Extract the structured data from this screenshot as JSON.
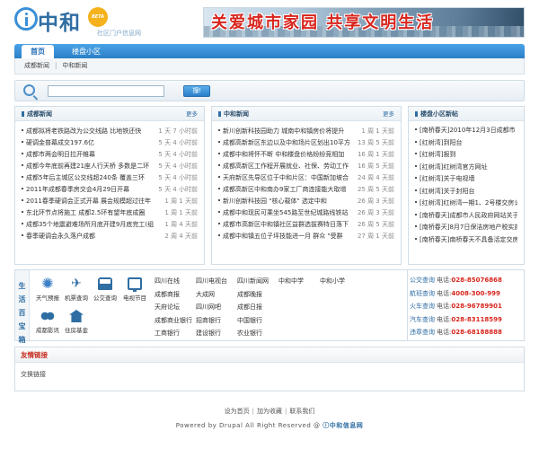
{
  "header": {
    "logo_title": "中和",
    "logo_badge": "BETA",
    "logo_subtitle": "社区门户信息网",
    "banner_text": "关爱城市家园 共享文明生活"
  },
  "nav": {
    "tabs": [
      {
        "label": "首页",
        "active": true
      },
      {
        "label": "楼盘小区",
        "active": false
      }
    ]
  },
  "subnav": {
    "items": [
      "成都新闻",
      "中和新闻"
    ]
  },
  "search": {
    "value": "",
    "placeholder": "",
    "button_label": "搜!"
  },
  "panels": {
    "chengdu_news": {
      "title": "成都新闻",
      "more": "更多",
      "items": [
        {
          "text": "成都拟将老铁路改为公交线路 比地铁还快",
          "time": "1 天 7 小时前"
        },
        {
          "text": "硬调金普幕成交197.6亿",
          "time": "5 天 4 小时前"
        },
        {
          "text": "成都市两会明日拉开帷幕",
          "time": "5 天 4 小时前"
        },
        {
          "text": "成都今年底前再建21座人行天桥 多数是二环",
          "time": "5 天 4 小时前"
        },
        {
          "text": "成都5年后主城区公交线超240条 覆盖三环",
          "time": "5 天 4 小时前"
        },
        {
          "text": "2011年成都春季房交会4月29日开幕",
          "time": "5 天 4 小时前"
        },
        {
          "text": "2011春季硬调会正式开幕 展会规模超过往年",
          "time": "1 周 1 天前"
        },
        {
          "text": "东北环节点将施工 成都2.5环有望年底成圈",
          "time": "1 周 1 天前"
        },
        {
          "text": "成都35个地震避难场所月底开建9月底完工(组",
          "time": "1 周 4 天前"
        },
        {
          "text": "春季硬调会永久落户成都",
          "time": "2 周 4 天前"
        }
      ]
    },
    "zhonghe_news": {
      "title": "中和新闻",
      "more": "更多",
      "items": [
        {
          "text": "新川创新科技园助力 城南中和镇房价将提升",
          "time": "1 周 1 天前"
        },
        {
          "text": "成都高新新区东边以及中和场片区划出10平方",
          "time": "13 周 5 天前"
        },
        {
          "text": "成都中和将怀不断 中和楼盘价格纷纷竞相加",
          "time": "16 周 1 天前"
        },
        {
          "text": "成都高新区工作程开展就业、社保、劳动工作",
          "time": "16 周 5 天前"
        },
        {
          "text": "天府新区先导区位于中和片区：中国新加坡合",
          "time": "24 周 4 天前"
        },
        {
          "text": "成都高新区中和南办9家工厂商连接能大取增",
          "time": "25 周 5 天前"
        },
        {
          "text": "新川创新科技园 \"核心载体\" 选定中和",
          "time": "26 周 3 天前"
        },
        {
          "text": "成都中和现民可乘坐545路至世纪城路线铁站",
          "time": "26 周 3 天前"
        },
        {
          "text": "成都市高新区中和镇社区益群选拔赛特日落下",
          "time": "26 周 5 天前"
        },
        {
          "text": "成都中和镇五位子坪技能进一月 群众 \"受群",
          "time": "27 周 1 天前"
        }
      ]
    },
    "property_news": {
      "title": "楼盘小区新帖",
      "items": [
        {
          "text": "[南桥春天]2010年12月3日成都市"
        },
        {
          "text": "[红树湾]到阳台"
        },
        {
          "text": "[红树湾]报到"
        },
        {
          "text": "[红树湾]红树湾官方网址"
        },
        {
          "text": "[红树湾]关于电视墙"
        },
        {
          "text": "[红树湾]关于封阳台"
        },
        {
          "text": "[红树湾]红树湾一期1、2号楼交房公"
        },
        {
          "text": "[南桥春天]成都市人民政府网站关于"
        },
        {
          "text": "[南桥春天]8月7日保洁房地产税实施"
        },
        {
          "text": "[南桥春天]南桥春天不具备活定交房"
        }
      ]
    }
  },
  "life": {
    "label_chars": [
      "生",
      "活",
      "百",
      "宝",
      "箱"
    ],
    "services": [
      {
        "label": "天气预报",
        "icon": "weather-icon"
      },
      {
        "label": "机票查询",
        "icon": "plane-icon"
      },
      {
        "label": "公交查询",
        "icon": "bus-icon"
      },
      {
        "label": "电视节目",
        "icon": "tv-icon"
      },
      {
        "label": "成都影讯",
        "icon": "movie-icon"
      },
      {
        "label": "住房基金",
        "icon": "house-icon"
      }
    ],
    "links": [
      [
        "四川在线",
        "四川电视台",
        "四川新闻网",
        "中和中学",
        "中和小学"
      ],
      [
        "成都商报",
        "大成网",
        "成都晚报"
      ],
      [
        "天府论坛",
        "四川网吧",
        "成都日报"
      ],
      [
        "成都商业银行",
        "招商银行",
        "中国银行"
      ],
      [
        "工商银行",
        "建设银行",
        "农业银行"
      ]
    ]
  },
  "phones": [
    {
      "label": "公交查询",
      "prefix": "电话:",
      "number": "028-85076868"
    },
    {
      "label": "航班查询",
      "prefix": "电话:",
      "number": "4008-300-999"
    },
    {
      "label": "火车查询",
      "prefix": "电话:",
      "number": "028-96789901"
    },
    {
      "label": "汽车查询",
      "prefix": "电话:",
      "number": "028-83118599"
    },
    {
      "label": "违章查询",
      "prefix": "电话:",
      "number": "028-68188888"
    }
  ],
  "friend_links": {
    "title": "友情链接",
    "items": [
      "交换链接"
    ]
  },
  "footer": {
    "links": [
      "设为首页",
      "加为收藏",
      "联系我们"
    ],
    "credit": "Powered by Drupal All Right Reserved @",
    "credit_logo": "中和信息网"
  }
}
